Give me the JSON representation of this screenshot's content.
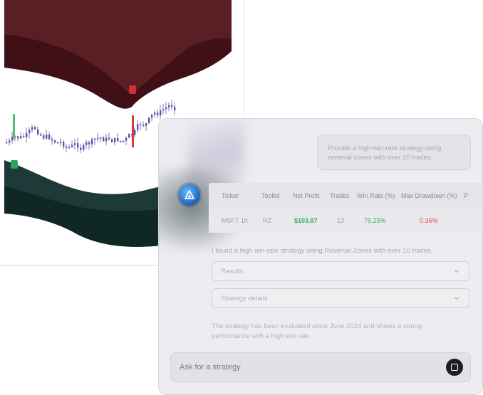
{
  "chart": {
    "x_ticks": [
      "",
      "",
      "",
      ""
    ],
    "y_ticks": [
      "",
      "",
      "",
      "",
      "",
      "",
      ""
    ]
  },
  "chat": {
    "user_message": "Provide a high-win-rate strategy using reversal zones with over 10 trades.",
    "results": {
      "columns": [
        "Ticker",
        "Toolkit",
        "Net Profit",
        "Trades",
        "Win Rate (%)",
        "Max Drawdown (%)",
        "P"
      ],
      "row": {
        "ticker": "MSFT 1h",
        "toolkit": "RZ",
        "net_profit": "$103.87",
        "trades": "13",
        "win_rate": "79.25%",
        "max_drawdown": "0.36%"
      }
    },
    "summary": "I found a high win-rate strategy using Reversal Zones with over 10 trades.",
    "accordions": [
      "Results",
      "Strategy details"
    ],
    "note": "The strategy has been evaluated since June 2024 and shows a strong performance with a high win rate.",
    "composer_placeholder": "Ask for a strategy"
  },
  "colors": {
    "upper_band": "#5a1e25",
    "upper_band_dark": "#3f1117",
    "lower_band": "#1d3a38",
    "lower_band_dark": "#0f2826",
    "candle_up": "#6a4ca8",
    "candle_down": "#d23b3b",
    "profit_green": "#3aa95e",
    "drawdown_red": "#e0484b",
    "send_button": "#1d1d26"
  },
  "icons": {
    "assistant": "triangle-logo-icon",
    "accordion": "chevron-down-icon",
    "send": "stop-square-icon"
  }
}
